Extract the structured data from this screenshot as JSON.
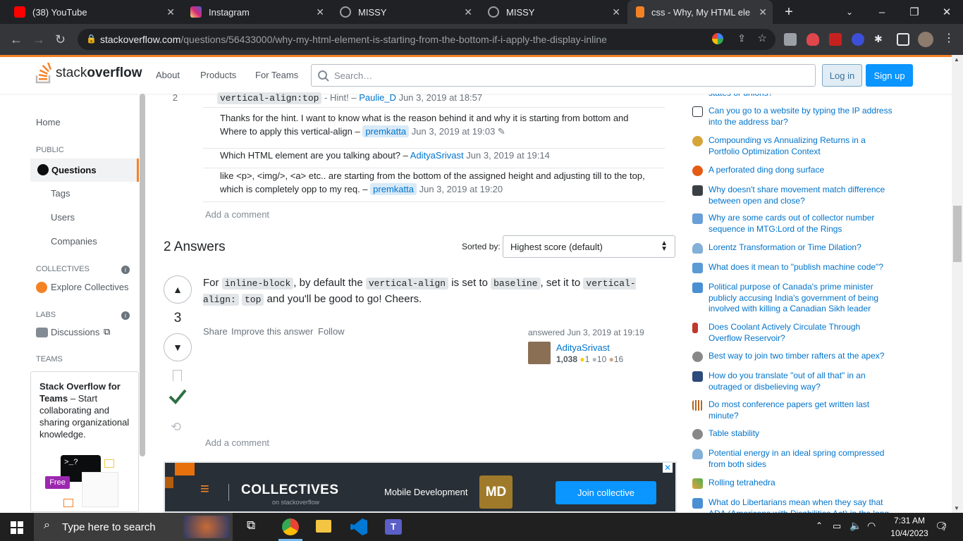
{
  "browser": {
    "tabs": [
      {
        "label": "(38) YouTube",
        "color": "#ff0000"
      },
      {
        "label": "Instagram",
        "color": "#d6249f"
      },
      {
        "label": "MISSY",
        "color": "#9aa0a6"
      },
      {
        "label": "MISSY",
        "color": "#9aa0a6"
      },
      {
        "label": "css - Why, My HTML eleme",
        "color": "#f48225"
      }
    ],
    "url_host": "stackoverflow.com",
    "url_path": "/questions/56433000/why-my-html-element-is-starting-from-the-bottom-if-i-apply-the-display-inline"
  },
  "so_header": {
    "logo_text_1": "stack",
    "logo_text_2": "overflow",
    "nav": [
      "About",
      "Products",
      "For Teams"
    ],
    "search_placeholder": "Search…",
    "login": "Log in",
    "signup": "Sign up"
  },
  "leftnav": {
    "home": "Home",
    "public": "PUBLIC",
    "questions": "Questions",
    "tags": "Tags",
    "users": "Users",
    "companies": "Companies",
    "collectives": "COLLECTIVES",
    "explore": "Explore Collectives",
    "labs": "LABS",
    "discussions": "Discussions",
    "teams": "TEAMS",
    "teams_title": "Stack Overflow for Teams",
    "teams_text": " – Start collaborating and sharing organizational knowledge.",
    "free": "Free"
  },
  "comments": [
    {
      "score": "2",
      "code": "vertical-align:top",
      "text": " - Hint! – ",
      "user": "Paulie_D",
      "date": "Jun 3, 2019 at 18:57"
    },
    {
      "text": "Thanks for the hint. I want to know what is the reason behind it and why it is starting from bottom and Where to apply this vertical-align – ",
      "user": "premkatta",
      "date": "Jun 3, 2019 at 19:03"
    },
    {
      "text": "Which HTML element are you talking about? – ",
      "user": "AdityaSrivast",
      "date": "Jun 3, 2019 at 19:14"
    },
    {
      "text": "like <p>, <img/>, <a> etc.. are starting from the bottom of the assigned height and adjusting till to the top, which is completely opp to my req. – ",
      "user": "premkatta",
      "date": "Jun 3, 2019 at 19:20"
    }
  ],
  "add_comment": "Add a comment",
  "answers": {
    "heading": "2 Answers",
    "sorted_by": "Sorted by:",
    "sort_value": "Highest score (default)",
    "vote_count": "3",
    "body_1": "For ",
    "code_1": "inline-block",
    "body_2": ", by default the ",
    "code_2": "vertical-align",
    "body_3": " is set to ",
    "code_3": "baseline",
    "body_4": ", set it to ",
    "code_4": "vertical-align:",
    "code_5": "top",
    "body_5": " and you'll be good to go! Cheers.",
    "share": "Share",
    "improve": "Improve this answer",
    "follow": "Follow",
    "answered": "answered Jun 3, 2019 at 19:19",
    "author": "AdityaSrivast",
    "rep": "1,038",
    "gold": "1",
    "silver": "10",
    "bronze": "16"
  },
  "ad": {
    "title": "COLLECTIVES",
    "subtitle": "on stackoverflow",
    "topic": "Mobile Development",
    "badge": "MD",
    "join": "Join collective"
  },
  "hot_questions": [
    {
      "title": "states or unions?",
      "color": "#9aa0a6"
    },
    {
      "title": "Can you go to a website by typing the IP address into the address bar?",
      "color": "#2f3337"
    },
    {
      "title": "Compounding vs Annualizing Returns in a Portfolio Optimization Context",
      "color": "#d6a53a"
    },
    {
      "title": "A perforated ding dong surface",
      "color": "#e55b13"
    },
    {
      "title": "Why doesn't share movement match difference between open and close?",
      "color": "#3b4045"
    },
    {
      "title": "Why are some cards out of collector number sequence in MTG:Lord of the Rings",
      "color": "#6a9fd8"
    },
    {
      "title": "Lorentz Transformation or Time Dilation?",
      "color": "#82b0d8"
    },
    {
      "title": "What does it mean to \"publish machine code\"?",
      "color": "#5b9bd5"
    },
    {
      "title": "Political purpose of Canada's prime minister publicly accusing India's government of being involved with killing a Canadian Sikh leader",
      "color": "#4a8fd4"
    },
    {
      "title": "Does Coolant Actively Circulate Through Overflow Reservoir?",
      "color": "#c0392b"
    },
    {
      "title": "Best way to join two timber rafters at the apex?",
      "color": "#888"
    },
    {
      "title": "How do you translate \"out of all that\" in an outraged or disbelieving way?",
      "color": "#2c4a7a"
    },
    {
      "title": "Do most conference papers get written last minute?",
      "color": "#b5651d"
    },
    {
      "title": "Table stability",
      "color": "#888"
    },
    {
      "title": "Potential energy in an ideal spring compressed from both sides",
      "color": "#82b0d8"
    },
    {
      "title": "Rolling tetrahedra",
      "color": "#e9a23b"
    },
    {
      "title": "What do Libertarians mean when they say that ADA (Americans with Disabilities Act) in the long",
      "color": "#4a8fd4"
    }
  ],
  "taskbar": {
    "search": "Type here to search",
    "time": "7:31 AM",
    "date": "10/4/2023",
    "notif": "2"
  }
}
